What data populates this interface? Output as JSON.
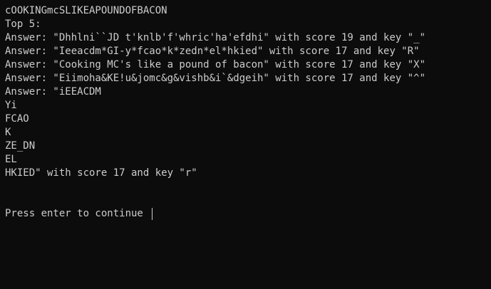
{
  "console": {
    "lines": [
      "cOOKINGmcSLIKEAPOUNDOFBACON",
      "Top 5:",
      "Answer: \"Dhhlni``JD t'knlb'f'whric'ha'efdhi\" with score 19 and key \"_\"",
      "Answer: \"Ieeacdm*GI-y*fcao*k*zedn*el*hkied\" with score 17 and key \"R\"",
      "Answer: \"Cooking MC's like a pound of bacon\" with score 17 and key \"X\"",
      "Answer: \"Eiimoha&KE!u&jomc&g&vishb&i`&dgeih\" with score 17 and key \"^\"",
      "Answer: \"iEEACDM",
      "Yi",
      "FCAO",
      "K",
      "ZE_DN",
      "EL",
      "HKIED\" with score 17 and key \"r\"",
      "",
      "",
      "Press enter to continue"
    ]
  },
  "colors": {
    "background": "#0c0c0c",
    "text": "#cccccc"
  }
}
